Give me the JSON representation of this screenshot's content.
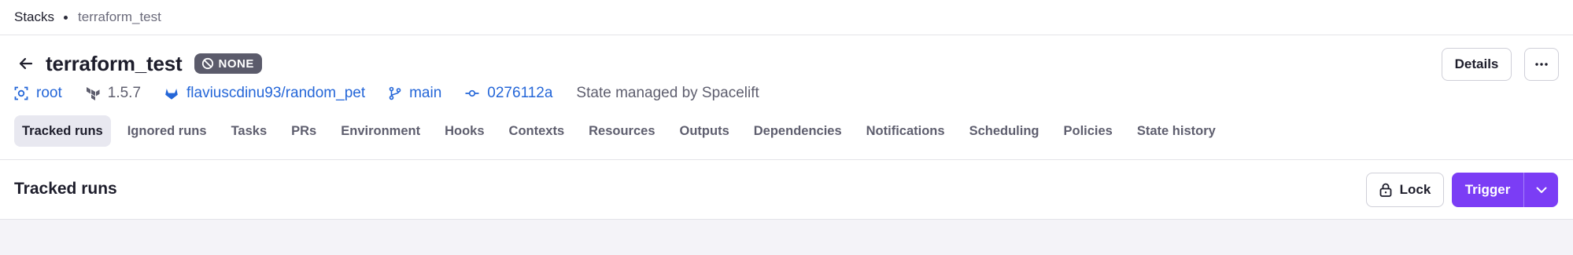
{
  "breadcrumb": {
    "root": "Stacks",
    "current": "terraform_test"
  },
  "stack": {
    "name": "terraform_test",
    "status": "NONE",
    "space": "root",
    "terraform_version": "1.5.7",
    "repository": "flaviuscdinu93/random_pet",
    "branch": "main",
    "commit": "0276112a",
    "state_text": "State managed by Spacelift"
  },
  "header_actions": {
    "details_label": "Details",
    "more_label": "···"
  },
  "tabs": [
    {
      "label": "Tracked runs",
      "active": true
    },
    {
      "label": "Ignored runs"
    },
    {
      "label": "Tasks"
    },
    {
      "label": "PRs"
    },
    {
      "label": "Environment"
    },
    {
      "label": "Hooks"
    },
    {
      "label": "Contexts"
    },
    {
      "label": "Resources"
    },
    {
      "label": "Outputs"
    },
    {
      "label": "Dependencies"
    },
    {
      "label": "Notifications"
    },
    {
      "label": "Scheduling"
    },
    {
      "label": "Policies"
    },
    {
      "label": "State history"
    }
  ],
  "section": {
    "title": "Tracked runs",
    "lock_label": "Lock",
    "trigger_label": "Trigger"
  },
  "colors": {
    "accent": "#7b3df5",
    "link": "#2466d8",
    "badge": "#5b5b6b",
    "tab_active_bg": "#e8e8f0"
  },
  "icons": {
    "back": "arrow-left-icon",
    "status": "ban-icon",
    "space": "space-target-icon",
    "terraform": "terraform-icon",
    "repository": "gitlab-icon",
    "branch": "git-branch-icon",
    "commit": "git-commit-icon",
    "lock": "lock-icon",
    "dropdown": "chevron-down-icon"
  }
}
